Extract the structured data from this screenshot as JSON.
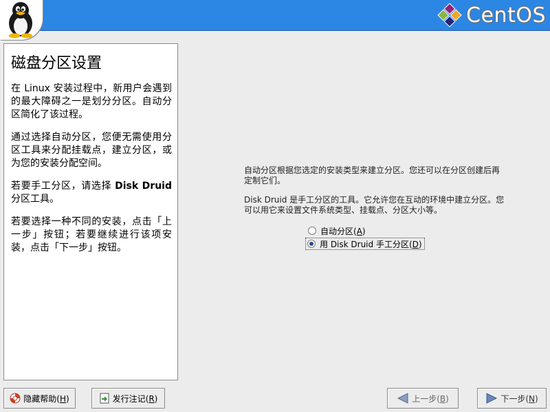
{
  "header": {
    "brand_name": "CentOS",
    "mascot_icon": "tux-penguin-icon",
    "brand_icon": "centos-logo-icon",
    "colors": {
      "bar": "#2c86e3",
      "accent_purple": "#932279",
      "accent_green": "#8cb53e",
      "accent_yellow": "#efa724",
      "accent_blue": "#262577"
    }
  },
  "help": {
    "title": "磁盘分区设置",
    "p1": "在 Linux 安装过程中，新用户会遇到的最大障碍之一是划分分区。自动分区简化了该过程。",
    "p2": "通过选择自动分区，您便无需使用分区工具来分配挂载点，建立分区，或为您的安装分配空间。",
    "p3_prefix": "若要手工分区，请选择 ",
    "p3_bold": "Disk Druid",
    "p3_suffix": " 分区工具。",
    "p4": "若要选择一种不同的安装，点击「上一步」按钮；若要继续进行该项安装，点击「下一步」按钮。"
  },
  "main": {
    "description1": "自动分区根据您选定的安装类型来建立分区。您还可以在分区创建后再定制它们。",
    "description2": "Disk Druid 是手工分区的工具。它允许您在互动的环境中建立分区。您可以用它来设置文件系统类型、挂载点、分区大小等。",
    "options": [
      {
        "label": "自动分区(",
        "mnemonic": "A",
        "suffix": ")",
        "selected": false
      },
      {
        "label": "用 Disk Druid 手工分区(",
        "mnemonic": "D",
        "suffix": ")",
        "selected": true
      }
    ]
  },
  "buttons": {
    "hide_help": {
      "label": "隐藏帮助(",
      "mnemonic": "H",
      "suffix": ")",
      "icon": "lifebuoy-icon"
    },
    "release_notes": {
      "label": "发行注记(",
      "mnemonic": "R",
      "suffix": ")",
      "icon": "notes-icon"
    },
    "back": {
      "label": "上一步(",
      "mnemonic": "B",
      "suffix": ")",
      "icon": "arrow-left-icon"
    },
    "next": {
      "label": "下一步(",
      "mnemonic": "N",
      "suffix": ")",
      "icon": "arrow-right-icon"
    }
  }
}
